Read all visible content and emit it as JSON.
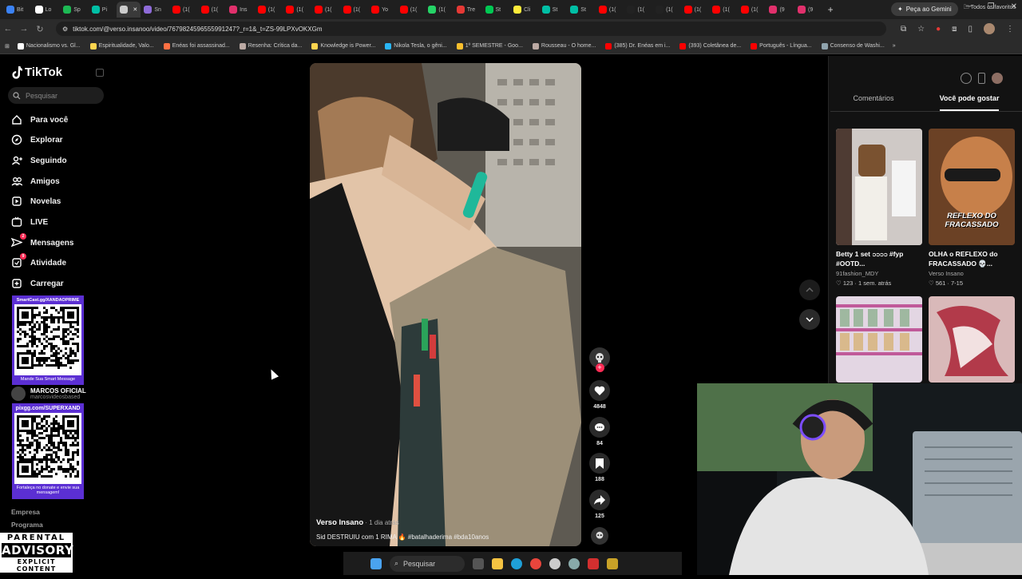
{
  "browser": {
    "tabs": [
      {
        "label": "Bit",
        "color": "#3b82f6"
      },
      {
        "label": "Lo",
        "color": "#ffffff"
      },
      {
        "label": "Sp",
        "color": "#1db954"
      },
      {
        "label": "Pi",
        "color": "#00bfa5"
      },
      {
        "label": "",
        "color": "#cccccc",
        "active": true
      },
      {
        "label": "Sn",
        "color": "#8e6bd8"
      },
      {
        "label": "(1(",
        "color": "#ff0000"
      },
      {
        "label": "(1(",
        "color": "#ff0000"
      },
      {
        "label": "Ins",
        "color": "#e1306c"
      },
      {
        "label": "(1(",
        "color": "#ff0000"
      },
      {
        "label": "(1(",
        "color": "#ff0000"
      },
      {
        "label": "(1(",
        "color": "#ff0000"
      },
      {
        "label": "(1(",
        "color": "#ff0000"
      },
      {
        "label": "Yo",
        "color": "#ff0000"
      },
      {
        "label": "(1(",
        "color": "#ff0000"
      },
      {
        "label": "(1(",
        "color": "#25d366"
      },
      {
        "label": "Tre",
        "color": "#e53935"
      },
      {
        "label": "St",
        "color": "#00c853"
      },
      {
        "label": "Cli",
        "color": "#ffeb3b"
      },
      {
        "label": "St",
        "color": "#00bfa5"
      },
      {
        "label": "St",
        "color": "#00bfa5"
      },
      {
        "label": "(1(",
        "color": "#ff0000"
      },
      {
        "label": "(1(",
        "color": "#222222"
      },
      {
        "label": "(1(",
        "color": "#222222"
      },
      {
        "label": "(1(",
        "color": "#ff0000"
      },
      {
        "label": "(1(",
        "color": "#ff0000"
      },
      {
        "label": "(1(",
        "color": "#ff0000"
      },
      {
        "label": "(9",
        "color": "#e1306c"
      },
      {
        "label": "(9",
        "color": "#e1306c"
      }
    ],
    "new_tab_label": "+",
    "gemini_label": "Peça ao Gemini",
    "url": "tiktok.com/@verso.insanoo/video/7679824596555991247?_r=1&_t=ZS-99LPXvOKXGm",
    "bookmarks": [
      {
        "label": "Nacionalismo vs. Gl...",
        "color": "#ffffff"
      },
      {
        "label": "Espiritualidade, Valo...",
        "color": "#ffd54f"
      },
      {
        "label": "Enéas foi assassinad...",
        "color": "#ff7043"
      },
      {
        "label": "Resenha: Crítica da...",
        "color": "#bcaaa4"
      },
      {
        "label": "Knowledge is Power...",
        "color": "#ffd54f"
      },
      {
        "label": "Nikola Tesla, o gêni...",
        "color": "#29b6f6"
      },
      {
        "label": "1º SEMESTRE - Goo...",
        "color": "#fbc02d"
      },
      {
        "label": "Rousseau - O home...",
        "color": "#bcaaa4"
      },
      {
        "label": "(385) Dr. Enéas em i...",
        "color": "#ff0000"
      },
      {
        "label": "(393) Coletânea de...",
        "color": "#ff0000"
      },
      {
        "label": "Português - Língua...",
        "color": "#ff0000"
      },
      {
        "label": "Consenso de Washi...",
        "color": "#90a4ae"
      }
    ],
    "all_favorites_label": "Todos os favoritos"
  },
  "tiktok": {
    "logo": "TikTok",
    "search_placeholder": "Pesquisar",
    "nav": [
      {
        "label": "Para você",
        "icon": "home-icon"
      },
      {
        "label": "Explorar",
        "icon": "compass-icon"
      },
      {
        "label": "Seguindo",
        "icon": "following-icon"
      },
      {
        "label": "Amigos",
        "icon": "friends-icon"
      },
      {
        "label": "Novelas",
        "icon": "novelas-icon"
      },
      {
        "label": "LIVE",
        "icon": "live-icon"
      },
      {
        "label": "Mensagens",
        "icon": "messages-icon",
        "badge": "2"
      },
      {
        "label": "Atividade",
        "icon": "activity-icon",
        "badge": "9"
      },
      {
        "label": "Carregar",
        "icon": "upload-icon"
      }
    ],
    "qr1": {
      "title": "SmartCast.gg/XANDAOPRIME",
      "foot": "Mande Sua Smart Message"
    },
    "following_user": {
      "name": "MARCOS OFICIAL",
      "handle": "marcosvideosbased"
    },
    "qr2": {
      "title": "pixgg.com/SUPERXAND",
      "foot": "Fortaleça no donate e envie sua mensagem!"
    },
    "footer_links": [
      "Empresa",
      "Programa"
    ],
    "video": {
      "author": "Verso Insano",
      "time": " · 1 dia atrás",
      "caption": "Sid DESTRUIU com 1 RIMA 🔥 #batalhaderima #bda10anos"
    },
    "actions": {
      "likes": "4848",
      "comments": "84",
      "saves": "188",
      "shares": "125"
    },
    "panel_tabs": [
      "Comentários",
      "Você pode gostar"
    ],
    "recommendations": [
      {
        "title": "Betty 1 set ၁၁၁၁ #fyp #OOTD...",
        "author": "91fashion_MDY",
        "likes": "123",
        "time": "1 sem. atrás"
      },
      {
        "title": "OLHA o REFLEXO do FRACASSADO 💀...",
        "author": "Verso Insano",
        "likes": "561",
        "time": "7-15",
        "overlay": "REFLEXO DO FRACASSADO"
      }
    ]
  },
  "parental_advisory": {
    "line1": "PARENTAL",
    "line2": "ADVISORY",
    "line3": "EXPLICIT CONTENT"
  },
  "taskbar": {
    "search_label": "Pesquisar"
  }
}
